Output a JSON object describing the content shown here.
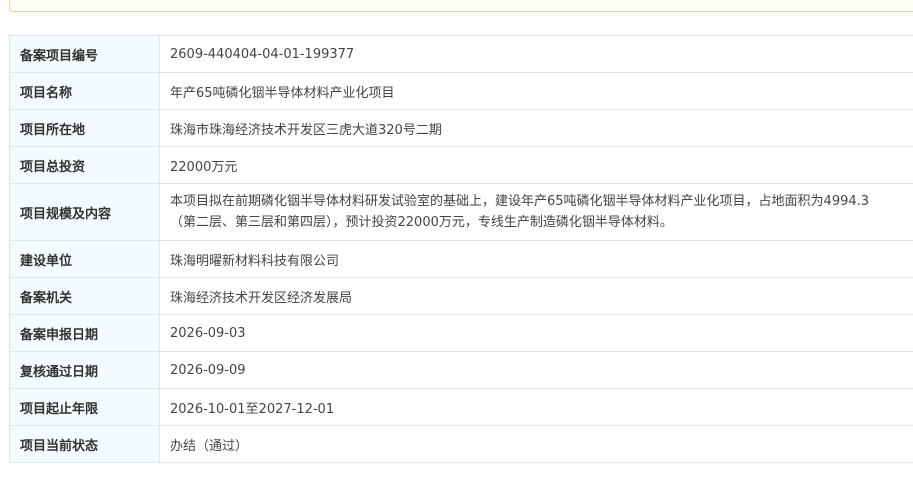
{
  "rows": [
    {
      "label": "备案项目编号",
      "value": "2609-440404-04-01-199377"
    },
    {
      "label": "项目名称",
      "value": "年产65吨磷化铟半导体材料产业化项目"
    },
    {
      "label": "项目所在地",
      "value": "珠海市珠海经济技术开发区三虎大道320号二期"
    },
    {
      "label": "项目总投资",
      "value": "22000万元"
    },
    {
      "label": "项目规模及内容",
      "value_line1": "本项目拟在前期磷化铟半导体材料研发试验室的基础上，建设年产65吨磷化铟半导体材料产业化项目，占地面积为4994.3",
      "value_line2": "（第二层、第三层和第四层），预计投资22000万元，专线生产制造磷化铟半导体材料。"
    },
    {
      "label": "建设单位",
      "value": "珠海明曜新材料科技有限公司"
    },
    {
      "label": "备案机关",
      "value": "珠海经济技术开发区经济发展局"
    },
    {
      "label": "备案申报日期",
      "value": "2026-09-03"
    },
    {
      "label": "复核通过日期",
      "value": "2026-09-09"
    },
    {
      "label": "项目起止年限",
      "value": "2026-10-01至2027-12-01"
    },
    {
      "label": "项目当前状态",
      "value": "办结（通过）"
    }
  ]
}
